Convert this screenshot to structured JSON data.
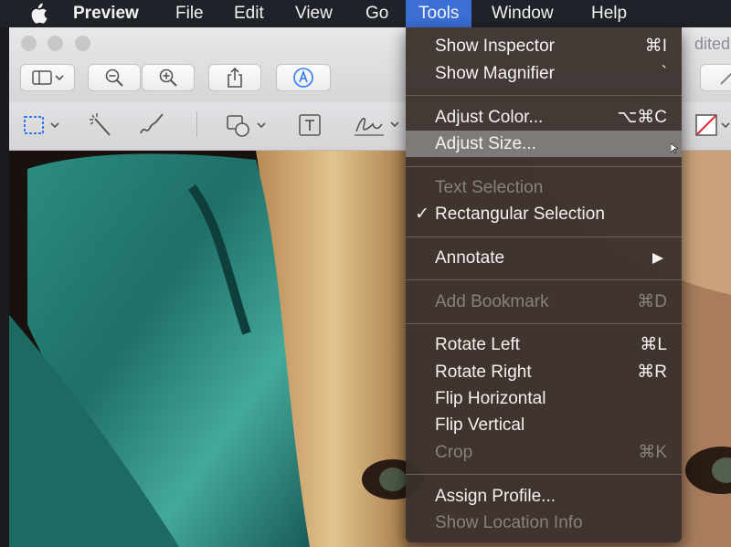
{
  "menubar": {
    "app_name": "Preview",
    "items": [
      "File",
      "Edit",
      "View",
      "Go",
      "Tools",
      "Window",
      "Help"
    ],
    "active_item": "Tools",
    "active_color": "#3b6fd6"
  },
  "window": {
    "title_fragment": "dited"
  },
  "tools_menu": {
    "items": [
      {
        "label": "Show Inspector",
        "shortcut": "⌘I"
      },
      {
        "label": "Show Magnifier",
        "shortcut": "`"
      },
      {
        "label": "Adjust Color...",
        "shortcut": "⌥⌘C"
      },
      {
        "label": "Adjust Size..."
      },
      {
        "label": "Text Selection"
      },
      {
        "label": "Rectangular Selection",
        "checkmark": "✓"
      },
      {
        "label": "Annotate"
      },
      {
        "label": "Add Bookmark",
        "shortcut": "⌘D"
      },
      {
        "label": "Rotate Left",
        "shortcut": "⌘L"
      },
      {
        "label": "Rotate Right",
        "shortcut": "⌘R"
      },
      {
        "label": "Flip Horizontal"
      },
      {
        "label": "Flip Vertical"
      },
      {
        "label": "Crop",
        "shortcut": "⌘K"
      },
      {
        "label": "Assign Profile..."
      },
      {
        "label": "Show Location Info"
      }
    ],
    "highlighted_item": "Adjust Size...",
    "disabled_items": [
      "Text Selection",
      "Add Bookmark",
      "Crop",
      "Show Location Info"
    ],
    "checked_item": "Rectangular Selection",
    "submenu_item": "Annotate"
  },
  "icons": {
    "toolbar": [
      "sidebar-icon",
      "zoom-out-icon",
      "zoom-in-icon",
      "share-icon",
      "markup-icon"
    ],
    "markup": [
      "rectangle-selection-icon",
      "instant-alpha-icon",
      "sketch-icon",
      "shapes-icon",
      "text-icon",
      "signature-icon",
      "border-color-icon"
    ]
  }
}
